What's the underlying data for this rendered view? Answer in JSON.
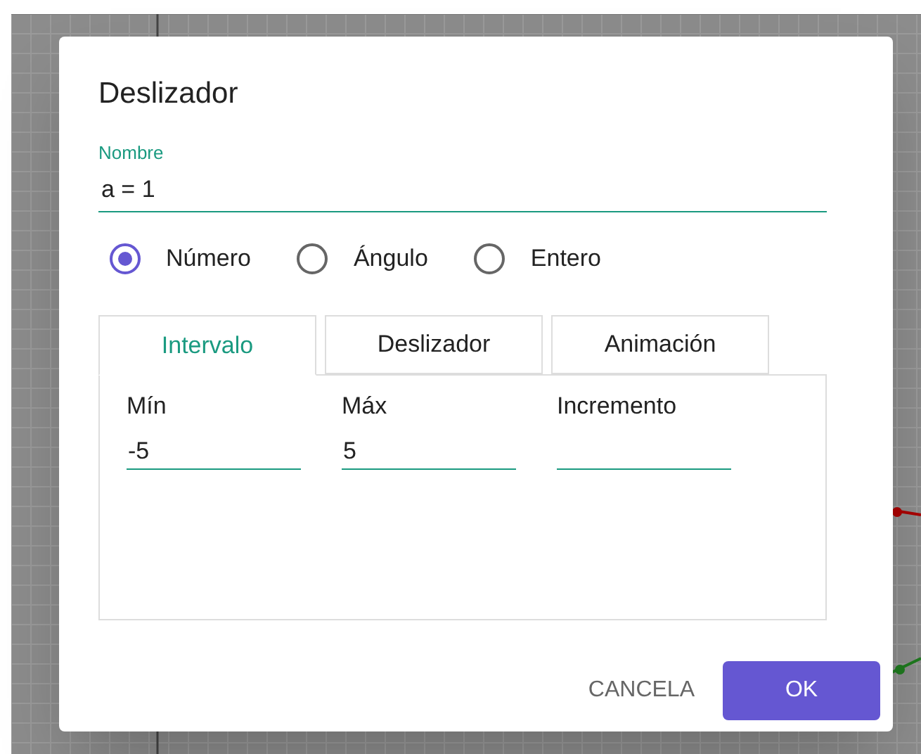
{
  "dialog": {
    "title": "Deslizador",
    "name_field": {
      "label": "Nombre",
      "value": "a = 1"
    },
    "types": [
      {
        "label": "Número",
        "selected": true
      },
      {
        "label": "Ángulo",
        "selected": false
      },
      {
        "label": "Entero",
        "selected": false
      }
    ],
    "tabs": [
      {
        "label": "Intervalo",
        "selected": true
      },
      {
        "label": "Deslizador",
        "selected": false
      },
      {
        "label": "Animación",
        "selected": false
      }
    ],
    "fields": [
      {
        "label": "Mín",
        "value": "-5"
      },
      {
        "label": "Máx",
        "value": "5"
      },
      {
        "label": "Incremento"
      }
    ],
    "buttons": [
      {
        "label": "CANCELA",
        "kind": "text"
      },
      {
        "label": "OK",
        "kind": "primary"
      }
    ]
  }
}
